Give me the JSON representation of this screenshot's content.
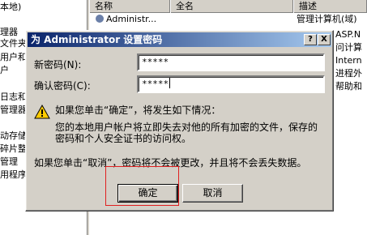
{
  "background": {
    "tree_items": [
      "本地)",
      "理器",
      "文件夹",
      "用户和",
      "户",
      "日志和",
      "管理器",
      "动存储",
      "碎片整",
      "管理",
      "用程序"
    ],
    "columns": [
      "名称",
      "全名",
      "描述"
    ],
    "rows": [
      {
        "name": "Administr...",
        "description": "管理计算机(域)"
      },
      {
        "name": "",
        "description": "ASP.N"
      },
      {
        "name": "",
        "description": "问计算"
      },
      {
        "name": "",
        "description": "Intern"
      },
      {
        "name": "",
        "description": "进程外"
      },
      {
        "name": "",
        "description": "帮助和"
      }
    ]
  },
  "dialog": {
    "title": "为 Administrator 设置密码",
    "help_button": "?",
    "close_button": "X",
    "new_password_label": "新密码(N):",
    "new_password_value": "*****",
    "confirm_password_label": "确认密码(C):",
    "confirm_password_value": "*****",
    "warning_line": "如果您单击“确定”，将发生如下情况：",
    "detail_line_1": "您的本地用户帐户将立即失去对他的所有加密的文件，保存的",
    "detail_line_2": "密码和个人安全证书的访问权。",
    "cancel_note": "如果您单击“取消”，密码将不会被更改，并且将不会丢失数据。",
    "ok_button": "确定",
    "cancel_button": "取消"
  },
  "colors": {
    "title_gradient_start": "#0a246a",
    "title_gradient_end": "#a6caf0",
    "highlight_box": "#e02020",
    "warning_icon": "#ffcc00"
  }
}
